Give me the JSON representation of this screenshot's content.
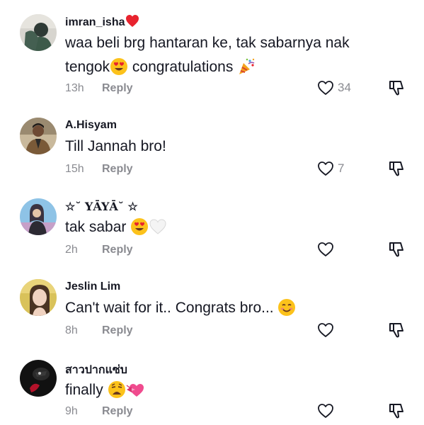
{
  "comments": [
    {
      "username": "imran_isha",
      "username_emoji": "red-heart-icon",
      "text_line1": "waa beli brg hantaran ke, tak sabarnya nak",
      "text_line2_a": "tengok",
      "text_line2_b": " congratulations",
      "time": "13h",
      "reply": "Reply",
      "likes": "34"
    },
    {
      "username": "A.Hisyam",
      "text": "Till Jannah bro!",
      "time": "15h",
      "reply": "Reply",
      "likes": "7"
    },
    {
      "username": "☆˘ YĀYĀ˘ ☆",
      "text": "tak sabar",
      "time": "2h",
      "reply": "Reply",
      "likes": ""
    },
    {
      "username": "Jeslin Lim",
      "text": "Can't wait for it.. Congrats bro...",
      "time": "8h",
      "reply": "Reply",
      "likes": ""
    },
    {
      "username": "สาวปากแซ่บ",
      "text": "finally",
      "time": "9h",
      "reply": "Reply",
      "likes": ""
    }
  ],
  "colors": {
    "text": "#161823",
    "secondary": "#8a8b91",
    "background": "#ffffff"
  }
}
